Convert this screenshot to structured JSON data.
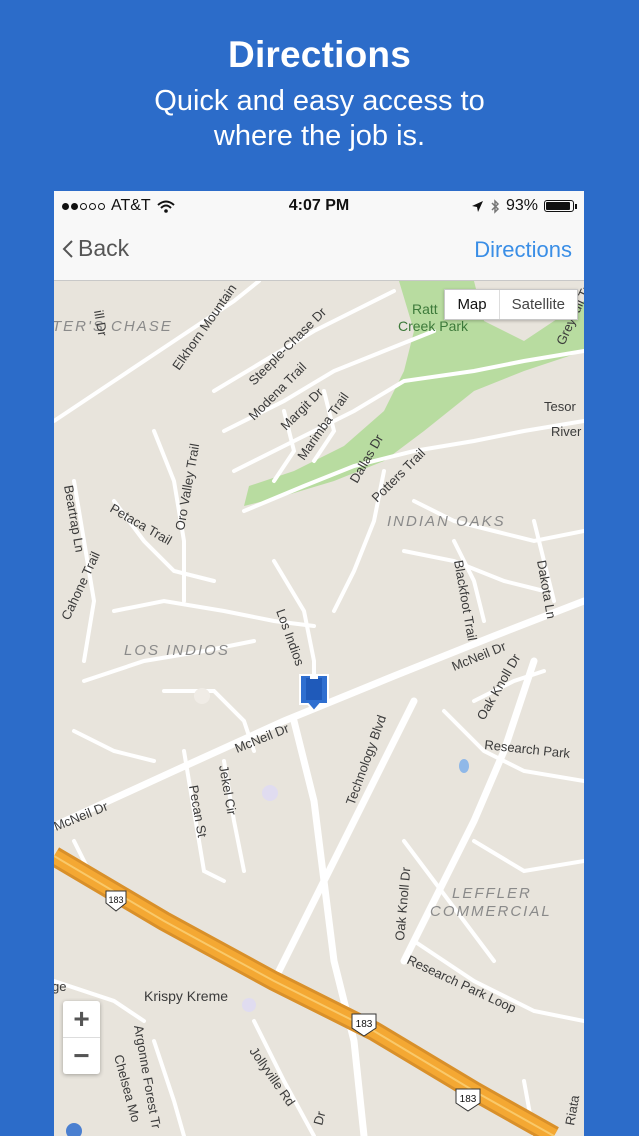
{
  "promo": {
    "title": "Directions",
    "subtitle_line1": "Quick and easy access to",
    "subtitle_line2": "where the job is."
  },
  "status_bar": {
    "carrier": "AT&T",
    "time": "4:07 PM",
    "battery": "93%",
    "battery_level": 0.93
  },
  "nav": {
    "back_label": "Back",
    "action_label": "Directions"
  },
  "map": {
    "type_options": [
      "Map",
      "Satellite"
    ],
    "selected_type": "Map",
    "zoom_in": "+",
    "zoom_out": "−",
    "areas": [
      "TER'S CHASE",
      "INDIAN OAKS",
      "LOS INDIOS",
      "LEFFLER",
      "COMMERCIAL",
      "Ratt",
      "Creek Park"
    ],
    "streets": [
      "Elkhorn Mountain",
      "Steeple-Chase Dr",
      "Modena Trail",
      "Margit Dr",
      "Marimba Trail",
      "Oro Valley Trail",
      "Beartrap Ln",
      "Petaca Trail",
      "Cahone Trail",
      "Dallas Dr",
      "Potters Trail",
      "Blackfoot Trail",
      "Dakota Ln",
      "Los Indios",
      "McNeil Dr",
      "Oak Knoll Dr",
      "Research Park",
      "Technology Blvd",
      "Jekel Cir",
      "Pecan St",
      "Research Park Loop",
      "Krispy Kreme",
      "Argonne Forest Tr",
      "Chelsea Mo",
      "Jollyville Rd",
      "Tesor",
      "River",
      "Greybull Tr",
      "ge",
      "Riata",
      "Dr",
      "ill Dr",
      "183"
    ],
    "accent_color": "#3a8ee6",
    "highway_color": "#f4a030",
    "park_color": "#a8d48c"
  }
}
